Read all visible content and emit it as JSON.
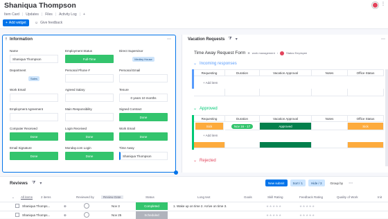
{
  "header": {
    "title": "Shaniqua Thompson",
    "tabs": [
      "Item Card",
      "Updates",
      "Files",
      "Activity Log"
    ],
    "add_widget": "Add widget",
    "feedback": "Give feedback"
  },
  "info": {
    "title": "Information",
    "fields": [
      {
        "label": "Name",
        "value": "Shaniqua Thompson",
        "kind": "box"
      },
      {
        "label": "Employment Status",
        "value": "Full-Time",
        "kind": "green"
      },
      {
        "label": "Direct Supervisor",
        "value": "Medley House",
        "kind": "pill"
      },
      {
        "label": "Department",
        "value": "Sales",
        "kind": "pill"
      },
      {
        "label": "Personal Phone #",
        "value": "",
        "kind": "empty"
      },
      {
        "label": "Personal Email",
        "value": "",
        "kind": "empty"
      },
      {
        "label": "Work Email",
        "value": "",
        "kind": "empty"
      },
      {
        "label": "Agreed Salary",
        "value": "",
        "kind": "empty"
      },
      {
        "label": "Tenure",
        "value": "0 years 10 months",
        "kind": "box"
      },
      {
        "label": "Employment Agreement",
        "value": "",
        "kind": "empty"
      },
      {
        "label": "Main Responsibility",
        "value": "",
        "kind": "empty"
      },
      {
        "label": "Signed Contract",
        "value": "Done",
        "kind": "green"
      },
      {
        "label": "Computer Received",
        "value": "Done",
        "kind": "green"
      },
      {
        "label": "Login Received",
        "value": "Done",
        "kind": "green"
      },
      {
        "label": "Work Email",
        "value": "Done",
        "kind": "green"
      },
      {
        "label": "Email Signature",
        "value": "Done",
        "kind": "green"
      },
      {
        "label": "Monday.com Login",
        "value": "Done",
        "kind": "green"
      },
      {
        "label": "Time Away",
        "value": "Shaniqua Thompson",
        "kind": "link"
      }
    ]
  },
  "vacation": {
    "title": "Vacation Requests",
    "form_title": "Time Away Request Form",
    "form_sub1": "work management",
    "form_sub2": "Status Employee",
    "columns": [
      "Requesting",
      "Duration",
      "Vacation Approval",
      "Notes",
      "Office Status"
    ],
    "groups": [
      {
        "name": "Incoming responses",
        "color": "#579bfc",
        "add_item": "+ Add item"
      },
      {
        "name": "Approved",
        "color": "#00c875",
        "add_item": "+ Add item",
        "row": {
          "requesting": "Sick",
          "duration": "Nov 16 - 17",
          "approval": "Approved",
          "notes": "",
          "office": "Sick"
        }
      },
      {
        "name": "Rejected",
        "color": "#e2445c"
      }
    ]
  },
  "reviews": {
    "title": "Reviews",
    "new_item": "New submit",
    "sort": "Sort / 1",
    "hide": "Hide / 3",
    "group": "Group by",
    "group_label": "All items",
    "group_count": "2 items",
    "columns": [
      "Reviewed by",
      "Review Date",
      "Status",
      "Long text",
      "Goals",
      "Skill Rating",
      "Feedback Rating",
      "Quality of Work",
      "Init"
    ],
    "rows": [
      {
        "name": "Shaniqua Thomps...",
        "date": "Nov 3",
        "status": "Completed",
        "long_text": "1. Wake up on time 2. Arrive on time 3.",
        "stars": "★★★★★"
      },
      {
        "name": "Shaniqua Thomps...",
        "date": "Nov 25",
        "status": "Scheduled",
        "long_text": "",
        "stars": "★★★★★"
      }
    ]
  },
  "colors": {
    "accent": "#0073ea",
    "green": "#33c46d",
    "orange": "#fdab3d",
    "dark_green": "#037f4c"
  }
}
